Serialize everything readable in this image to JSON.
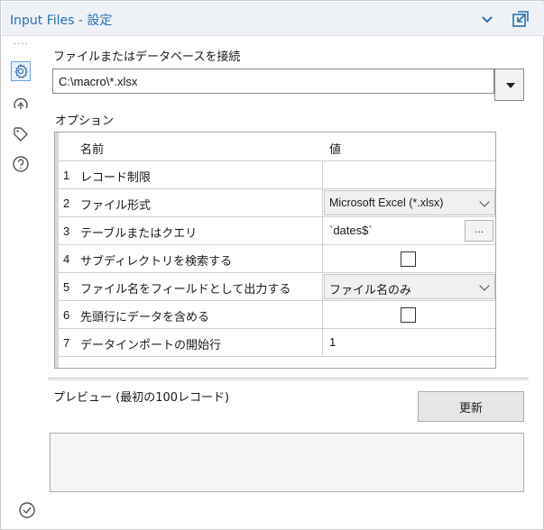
{
  "window": {
    "title": "Input Files - 設定"
  },
  "icons": {
    "title_chevron": "chevron-down-icon",
    "title_dock": "dock-window-icon",
    "rail": [
      "gear-icon",
      "connection-progress-icon",
      "tag-icon",
      "help-icon"
    ],
    "bottom": "checkmark-circle-icon"
  },
  "colors": {
    "accent": "#2a6fb0",
    "rail_active": "#6aa0d8"
  },
  "connect": {
    "label": "ファイルまたはデータベースを接続",
    "path_value": "C:\\macro\\*.xlsx"
  },
  "options": {
    "label": "オプション",
    "header": {
      "name": "名前",
      "value": "値"
    },
    "rows": [
      {
        "num": "1",
        "name": "レコード制限",
        "value": ""
      },
      {
        "num": "2",
        "name": "ファイル形式",
        "value": "Microsoft Excel (*.xlsx)"
      },
      {
        "num": "3",
        "name": "テーブルまたはクエリ",
        "value": "`dates$`",
        "button": "..."
      },
      {
        "num": "4",
        "name": "サブディレクトリを検索する",
        "checked": false
      },
      {
        "num": "5",
        "name": "ファイル名をフィールドとして出力する",
        "value": "ファイル名のみ"
      },
      {
        "num": "6",
        "name": "先頭行にデータを含める",
        "checked": false
      },
      {
        "num": "7",
        "name": "データインポートの開始行",
        "value": "1"
      }
    ]
  },
  "preview": {
    "label": "プレビュー (最初の100レコード)",
    "refresh_label": "更新"
  }
}
